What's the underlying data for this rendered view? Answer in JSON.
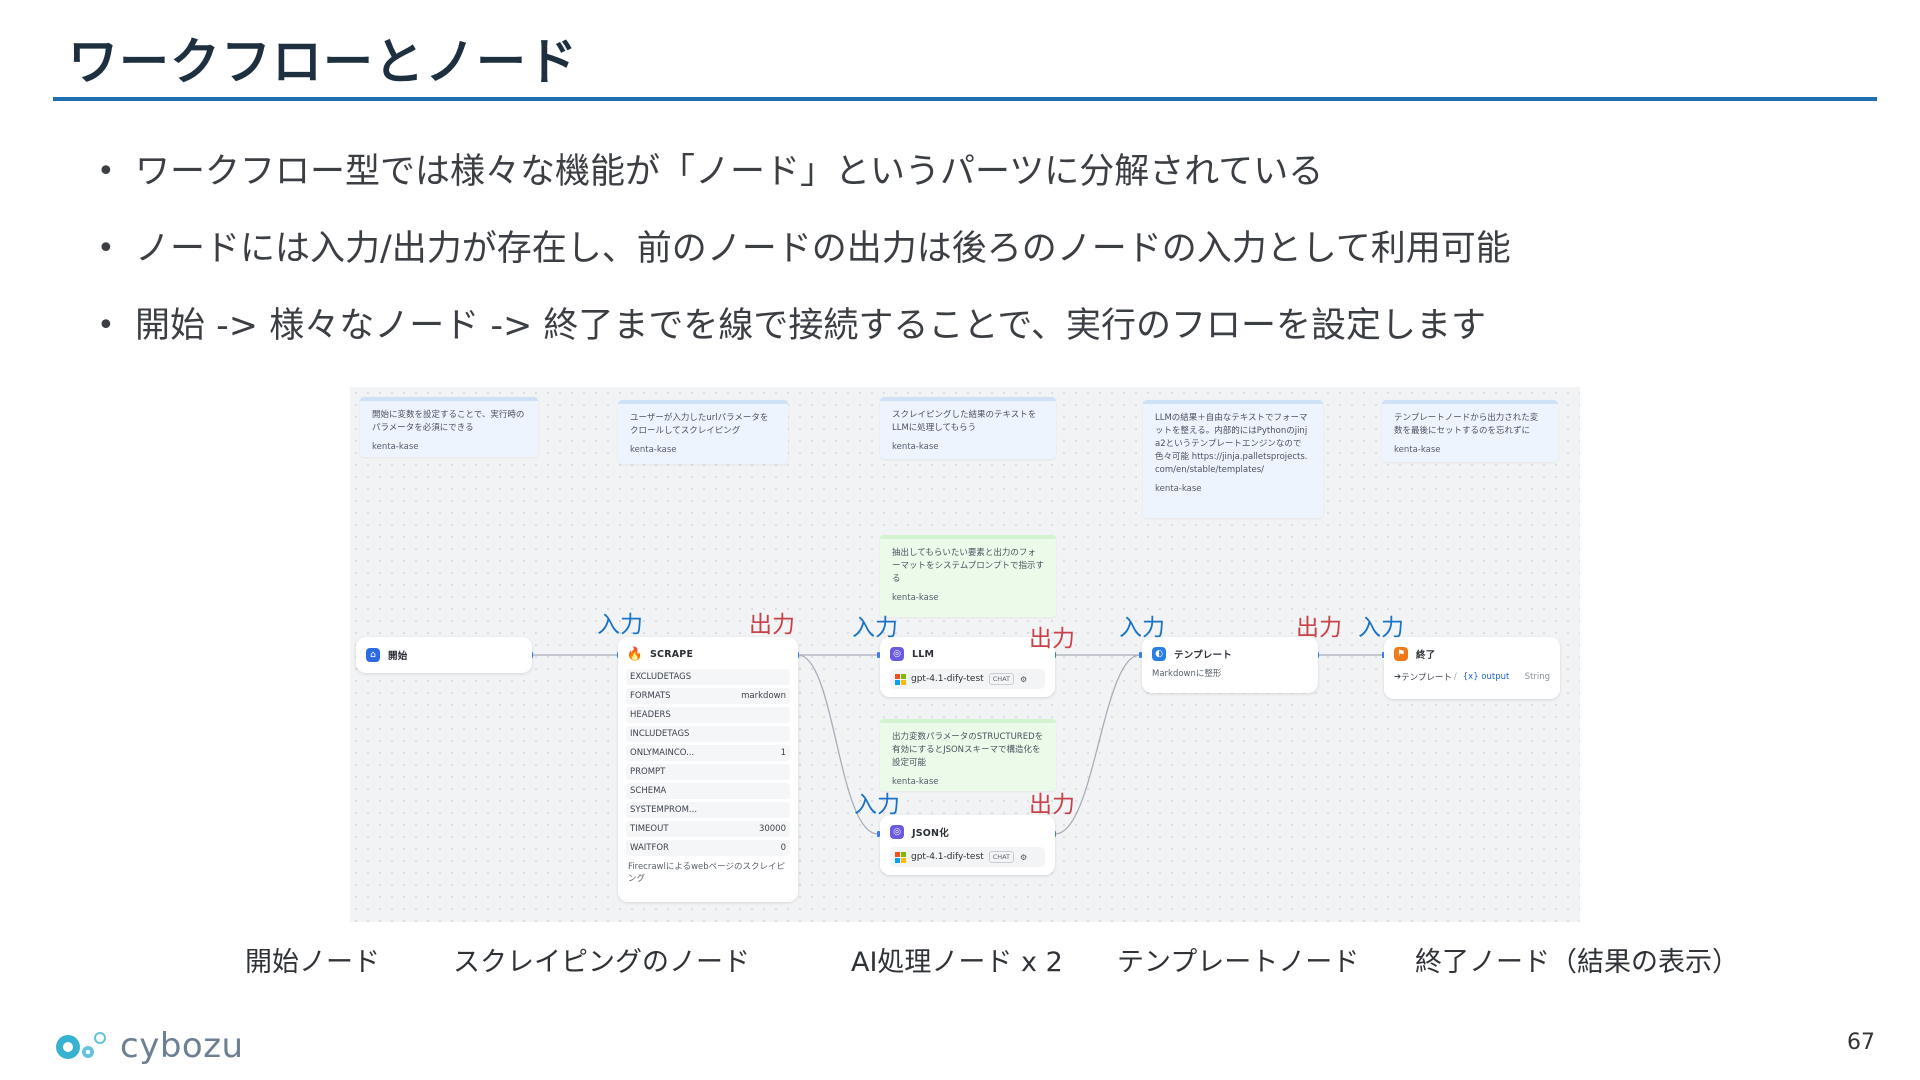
{
  "slide": {
    "title": "ワークフローとノード",
    "bullets": [
      "ワークフロー型では様々な機能が「ノード」というパーツに分解されている",
      "ノードには入力/出力が存在し、前のノードの出力は後ろのノードの入力として利用可能",
      "開始 -> 様々なノード -> 終了までを線で接続することで、実行のフローを設定します"
    ],
    "captions": [
      "開始ノード",
      "スクレイピングのノード",
      "AI処理ノード x 2",
      "テンプレートノード",
      "終了ノード（結果の表示）"
    ],
    "page_number": "67",
    "logo_text": "cybozu"
  },
  "workflow": {
    "notes": [
      {
        "text": "開始に変数を設定することで、実行時のパラメータを必須にできる",
        "author": "kenta-kase"
      },
      {
        "text": "ユーザーが入力したurlパラメータをクロールしてスクレイピング",
        "author": "kenta-kase"
      },
      {
        "text": "スクレイピングした結果のテキストをLLMに処理してもらう",
        "author": "kenta-kase"
      },
      {
        "text": "LLMの結果＋自由なテキストでフォーマットを整える。内部的にはPythonのjinja2というテンプレートエンジンなので色々可能 https://jinja.palletsprojects.com/en/stable/templates/",
        "author": "kenta-kase"
      },
      {
        "text": "テンプレートノードから出力された変数を最後にセットするのを忘れずに",
        "author": "kenta-kase"
      },
      {
        "text": "抽出してもらいたい要素と出力のフォーマットをシステムプロンプトで指示する",
        "author": "kenta-kase"
      },
      {
        "text": "出力変数パラメータのSTRUCTUREDを有効にするとJSONスキーマで構造化を設定可能",
        "author": "kenta-kase"
      }
    ],
    "nodes": {
      "start": {
        "title": "開始"
      },
      "scrape": {
        "title": "SCRAPE",
        "params": [
          {
            "key": "EXCLUDETAGS",
            "value": ""
          },
          {
            "key": "FORMATS",
            "value": "markdown"
          },
          {
            "key": "HEADERS",
            "value": ""
          },
          {
            "key": "INCLUDETAGS",
            "value": ""
          },
          {
            "key": "ONLYMAINCO...",
            "value": "1"
          },
          {
            "key": "PROMPT",
            "value": ""
          },
          {
            "key": "SCHEMA",
            "value": ""
          },
          {
            "key": "SYSTEMPROM...",
            "value": ""
          },
          {
            "key": "TIMEOUT",
            "value": "30000"
          },
          {
            "key": "WAITFOR",
            "value": "0"
          }
        ],
        "description": "Firecrawlによるwebページのスクレイピング"
      },
      "llm": {
        "title": "LLM",
        "model": "gpt-4.1-dify-test",
        "badge": "CHAT"
      },
      "json": {
        "title": "JSON化",
        "model": "gpt-4.1-dify-test",
        "badge": "CHAT"
      },
      "template": {
        "title": "テンプレート",
        "description": "Markdownに整形"
      },
      "end": {
        "title": "終了",
        "output_source": "テンプレート",
        "output_var": "{x} output",
        "output_type": "String"
      }
    },
    "io_labels": {
      "scrape_in": "入力",
      "scrape_out": "出力",
      "llm_in": "入力",
      "llm_out": "出力",
      "template_in": "入力",
      "template_out": "出力",
      "end_in": "入力",
      "json_in": "入力",
      "json_out": "出力"
    },
    "colors": {
      "input_label": "#1a74c4",
      "output_label": "#c8424a",
      "accent_rule": "#1f6fb0"
    }
  }
}
